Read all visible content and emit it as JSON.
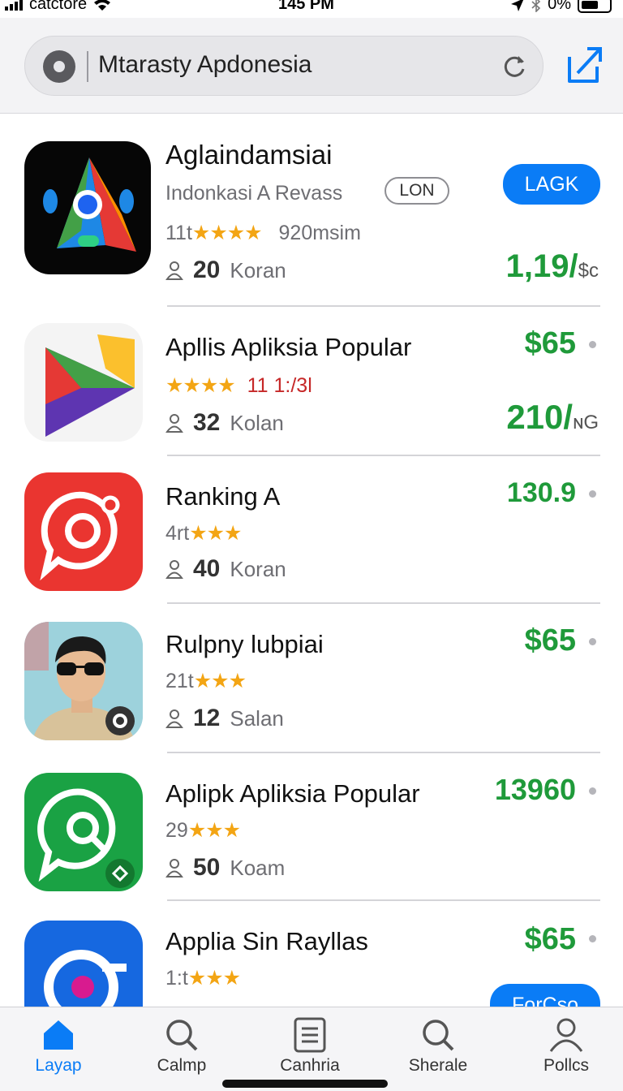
{
  "status_bar": {
    "carrier": "catctore",
    "time": "145 PM",
    "battery": "0%"
  },
  "search": {
    "value": "Mtarasty Apdonesia"
  },
  "apps": [
    {
      "name": "Aglaindamsiai",
      "subtitle": "Indonkasi A Revass",
      "tag": "LON",
      "action_label": "LAGK",
      "rating_prefix": "11t",
      "stars": "★★★★",
      "rating_suffix": "920msim",
      "count": "20",
      "count_label": "Koran",
      "price": "1,19/",
      "price_sub": "$c"
    },
    {
      "name": "Apllis Apliksia Popular",
      "rating_prefix": "",
      "stars": "★★★★",
      "rating_suffix": "11 1:/3l",
      "count": "32",
      "count_label": "Kolan",
      "price": "$65",
      "price2": "210/",
      "price2_sub": "ɴG"
    },
    {
      "name": "Ranking A",
      "rating_prefix": "4rt",
      "stars": "★★★",
      "count": "40",
      "count_label": "Koran",
      "price": "130.9"
    },
    {
      "name": "Rulpny lubpiai",
      "rating_prefix": "21t",
      "stars": "★★★",
      "count": "12",
      "count_label": "Salan",
      "price": "$65"
    },
    {
      "name": "Aplipk Apliksia Popular",
      "rating_prefix": "29",
      "stars": "★★★",
      "count": "50",
      "count_label": "Koam",
      "price": "13960"
    },
    {
      "name": "Applia Sin Rayllas",
      "rating_prefix": "1:t",
      "stars": "★★★",
      "price": "$65",
      "action_label": "ForCso"
    }
  ],
  "tabs": [
    {
      "label": "Layap",
      "icon": "home-icon",
      "active": true
    },
    {
      "label": "Calmp",
      "icon": "search-icon",
      "active": false
    },
    {
      "label": "Canhria",
      "icon": "list-icon",
      "active": false
    },
    {
      "label": "Sherale",
      "icon": "search-icon",
      "active": false
    },
    {
      "label": "Pollcs",
      "icon": "person-icon",
      "active": false
    }
  ],
  "colors": {
    "accent": "#0a7cf6",
    "price": "#1f9a3a",
    "star": "#f3a514"
  }
}
